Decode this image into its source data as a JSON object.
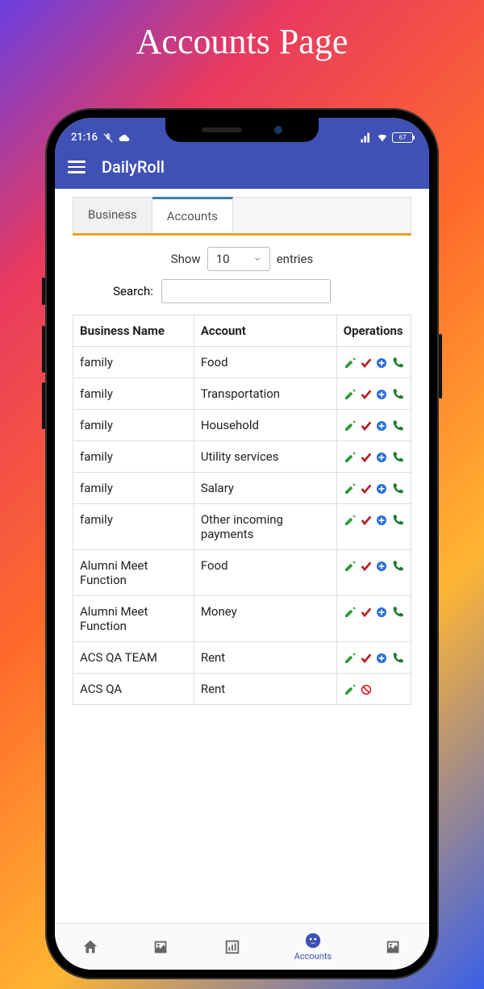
{
  "pageTitle": "Accounts Page",
  "status": {
    "time": "21:16",
    "battery": "67"
  },
  "appTitle": "DailyRoll",
  "tabs": {
    "business": "Business",
    "accounts": "Accounts",
    "active": "accounts"
  },
  "entries": {
    "showLabel": "Show",
    "entriesLabel": "entries",
    "selected": "10",
    "searchLabel": "Search:"
  },
  "columns": {
    "c1": "Business Name",
    "c2": "Account",
    "c3": "Operations"
  },
  "rows": [
    {
      "biz": "family",
      "acct": "Food",
      "ops": "full"
    },
    {
      "biz": "family",
      "acct": "Transportation",
      "ops": "full"
    },
    {
      "biz": "family",
      "acct": "Household",
      "ops": "full"
    },
    {
      "biz": "family",
      "acct": "Utility services",
      "ops": "full"
    },
    {
      "biz": "family",
      "acct": "Salary",
      "ops": "full"
    },
    {
      "biz": "family",
      "acct": "Other incoming payments",
      "ops": "full"
    },
    {
      "biz": "Alumni Meet Function",
      "acct": "Food",
      "ops": "full"
    },
    {
      "biz": "Alumni Meet Function",
      "acct": "Money",
      "ops": "full"
    },
    {
      "biz": "ACS QA TEAM",
      "acct": "Rent",
      "ops": "full"
    },
    {
      "biz": "ACS QA",
      "acct": "Rent",
      "ops": "partial"
    }
  ],
  "bottomNav": {
    "accounts": "Accounts"
  }
}
